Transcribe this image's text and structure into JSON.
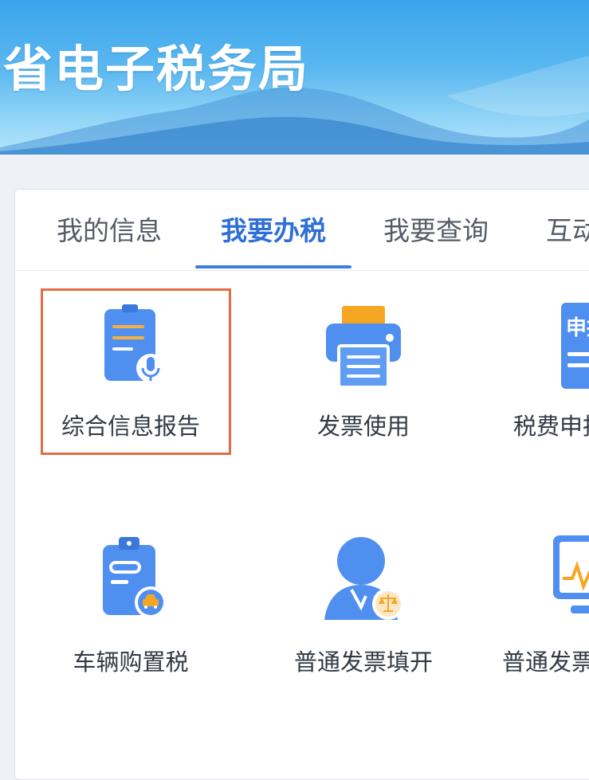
{
  "banner": {
    "title": "省电子税务局"
  },
  "tabs": [
    {
      "label": "我的信息",
      "active": false
    },
    {
      "label": "我要办税",
      "active": true
    },
    {
      "label": "我要查询",
      "active": false
    },
    {
      "label": "互动",
      "active": false
    }
  ],
  "tiles": [
    {
      "label": "综合信息报告",
      "icon": "report-microphone-icon",
      "highlighted": true
    },
    {
      "label": "发票使用",
      "icon": "printer-icon"
    },
    {
      "label": "税费申报",
      "icon": "tax-declaration-icon"
    },
    {
      "label": "车辆购置税",
      "icon": "vehicle-clipboard-icon"
    },
    {
      "label": "普通发票填开",
      "icon": "person-scale-icon"
    },
    {
      "label": "普通发票",
      "icon": "monitor-chart-icon"
    }
  ],
  "icon_texts": {
    "declare_badge": "申报"
  },
  "colors": {
    "accent": "#3b7de0",
    "active_tab_text": "#2f6fd6",
    "highlight_border": "#e26c45",
    "icon_blue": "#4f8ff0",
    "icon_orange": "#f5a623"
  }
}
